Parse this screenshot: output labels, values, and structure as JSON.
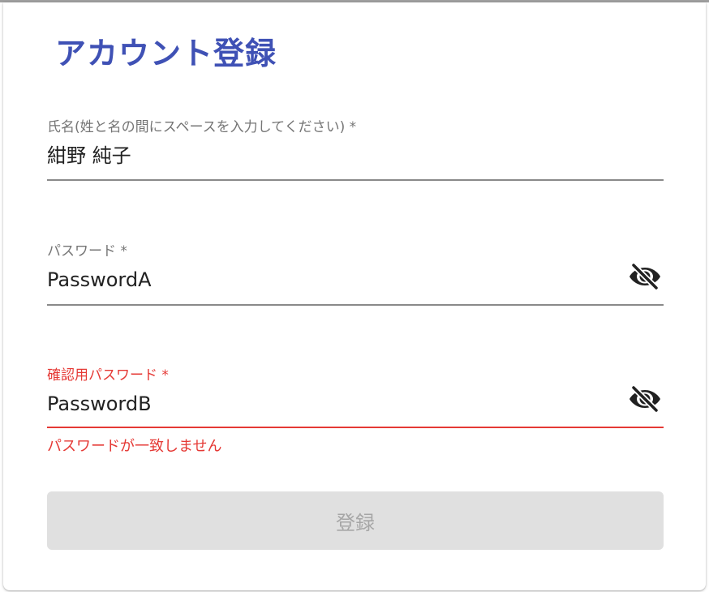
{
  "form": {
    "title": "アカウント登録",
    "name_field": {
      "label": "氏名(姓と名の間にスペースを入力してください) *",
      "value": "紺野 純子"
    },
    "password_field": {
      "label": "パスワード *",
      "value": "PasswordA",
      "toggle_icon": "eye-off-icon"
    },
    "confirm_field": {
      "label": "確認用パスワード *",
      "value": "PasswordB",
      "toggle_icon": "eye-off-icon",
      "error": "パスワードが一致しません"
    },
    "submit_label": "登録"
  },
  "colors": {
    "accent": "#3f51b5",
    "error": "#e53935",
    "text": "#212121",
    "label": "#757575",
    "disabled_bg": "#e0e0e0",
    "disabled_text": "#a6a6a6"
  }
}
